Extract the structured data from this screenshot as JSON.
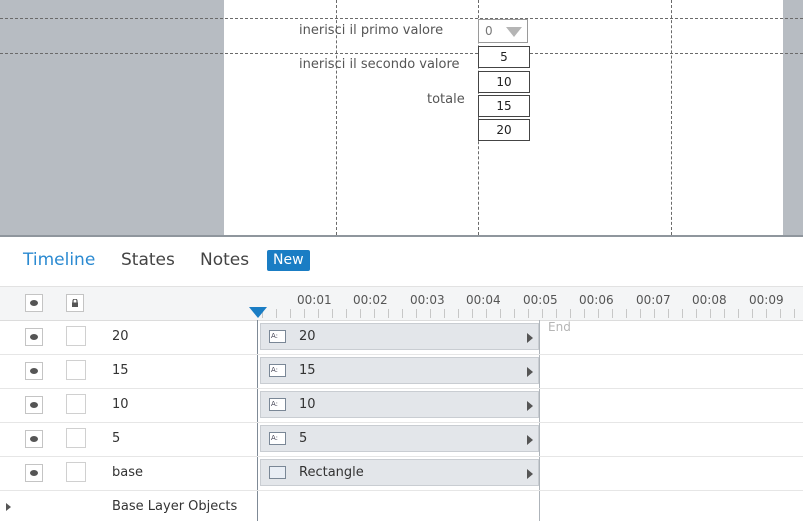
{
  "canvas": {
    "field1_label": "inerisci il primo valore",
    "field2_label": "inerisci il secondo valore",
    "total_label": "totale",
    "dropdown_value": "0",
    "options": [
      "5",
      "10",
      "15",
      "20"
    ]
  },
  "timeline": {
    "tabs": [
      "Timeline",
      "States",
      "Notes"
    ],
    "new_button": "New",
    "time_marks": [
      "00:01",
      "00:02",
      "00:03",
      "00:04",
      "00:05",
      "00:06",
      "00:07",
      "00:08",
      "00:09"
    ],
    "end_label": "End",
    "layers": [
      {
        "name": "20",
        "bar": "20"
      },
      {
        "name": "15",
        "bar": "15"
      },
      {
        "name": "10",
        "bar": "10"
      },
      {
        "name": "5",
        "bar": "5"
      },
      {
        "name": "base",
        "bar": "Rectangle"
      }
    ],
    "base_objects_label": "Base Layer Objects"
  },
  "colors": {
    "accent": "#1a7dc4",
    "canvas_bg": "#b7bcc2"
  }
}
